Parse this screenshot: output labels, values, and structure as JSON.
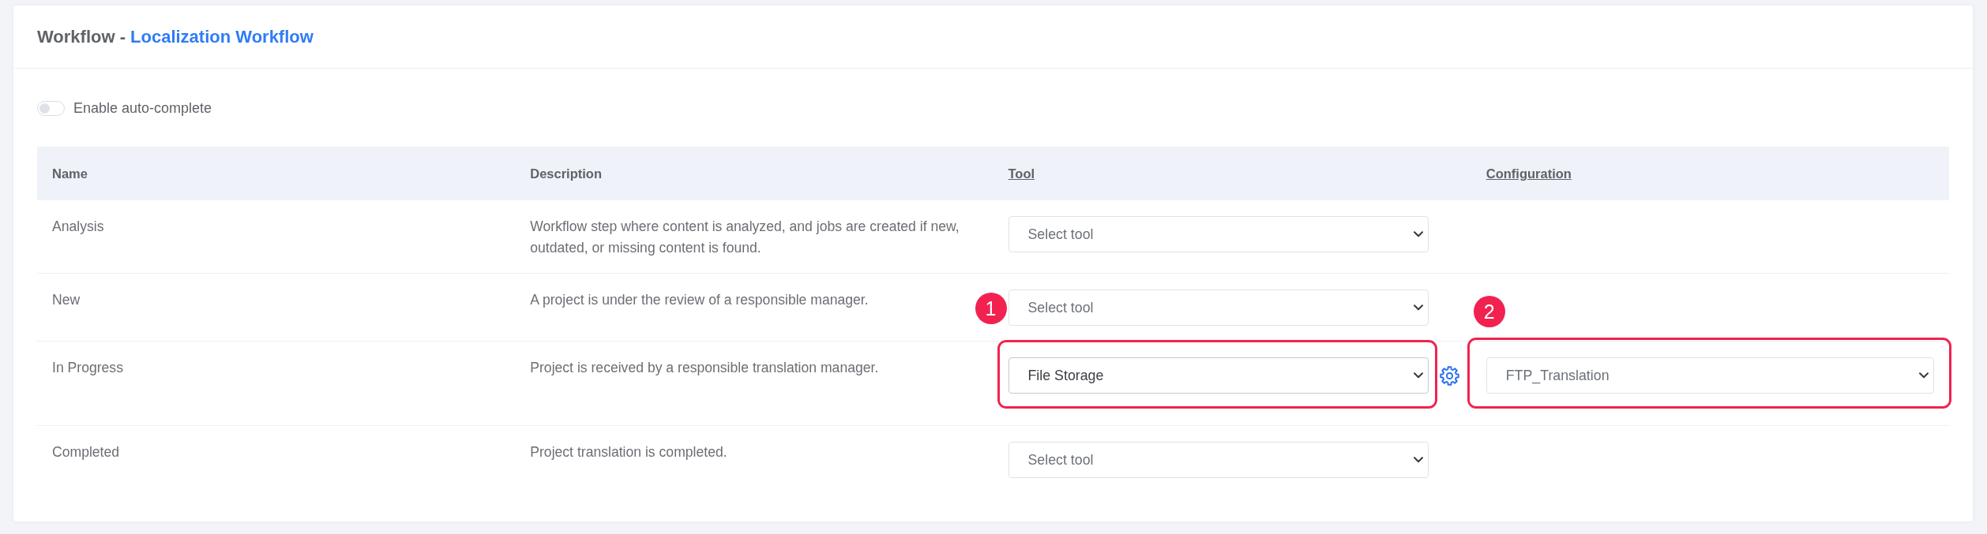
{
  "header": {
    "title": "Workflow -",
    "workflow_name": "Localization Workflow"
  },
  "auto_complete": {
    "label": "Enable auto-complete",
    "on": false
  },
  "table": {
    "columns": [
      {
        "label": "Name",
        "kind": "plain"
      },
      {
        "label": "Description",
        "kind": "plain"
      },
      {
        "label": "Tool",
        "kind": "link"
      },
      {
        "label": "Configuration",
        "kind": "link"
      }
    ],
    "rows": [
      {
        "name": "Analysis",
        "description": "Workflow step where content is analyzed, and jobs are created if new, outdated, or missing content is found.",
        "tool": {
          "placeholder": "Select tool"
        },
        "configurable": false
      },
      {
        "name": "New",
        "description": "A project is under the review of a responsible manager.",
        "tool": {
          "placeholder": "Select tool"
        },
        "configurable": false
      },
      {
        "name": "In Progress",
        "description": "Project is received by a responsible translation manager.",
        "tool": {
          "value": "File Storage",
          "callout": "1"
        },
        "configurable": true,
        "configuration": {
          "value": "FTP_Translation",
          "callout": "2"
        }
      },
      {
        "name": "Completed",
        "description": "Project translation is completed.",
        "tool": {
          "placeholder": "Select tool"
        },
        "configurable": false
      }
    ]
  }
}
